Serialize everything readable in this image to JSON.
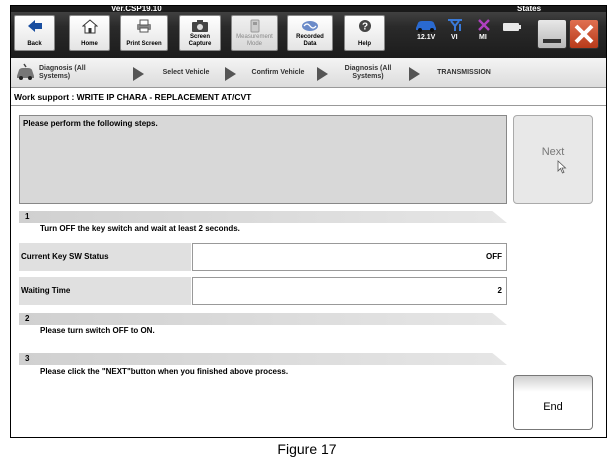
{
  "header": {
    "version": "Ver.CSP19.10",
    "states": "States"
  },
  "toolbar": {
    "back": "Back",
    "home": "Home",
    "print_screen": "Print Screen",
    "screen_capture": "Screen Capture",
    "measurement_mode": "Measurement Mode",
    "recorded_data": "Recorded Data",
    "help": "Help"
  },
  "status": {
    "battery_voltage": "12.1V",
    "vi": "VI",
    "mi": "MI"
  },
  "breadcrumbs": [
    "Diagnosis (All Systems)",
    "Select Vehicle",
    "Confirm Vehicle",
    "Diagnosis (All Systems)",
    "TRANSMISSION"
  ],
  "work_support": {
    "title": "Work support : WRITE IP CHARA - REPLACEMENT AT/CVT",
    "instruction": "Please perform the following steps.",
    "next_label": "Next",
    "end_label": "End"
  },
  "steps": [
    {
      "num": "1",
      "text": "Turn OFF the key switch and wait at least 2 seconds."
    },
    {
      "num": "2",
      "text": "Please turn switch OFF to ON."
    },
    {
      "num": "3",
      "text": "Please click the \"NEXT\"button when you finished above process."
    }
  ],
  "fields": [
    {
      "label": "Current Key SW Status",
      "value": "OFF"
    },
    {
      "label": "Waiting Time",
      "value": "2"
    }
  ],
  "caption": "Figure 17",
  "colors": {
    "toolbar_bg": "#2a2a2a",
    "panel_bg": "#d8d8d8",
    "close_red": "#c84a2a",
    "status_blue": "#1a4fa0",
    "mi_purple": "#8a2a9a"
  }
}
